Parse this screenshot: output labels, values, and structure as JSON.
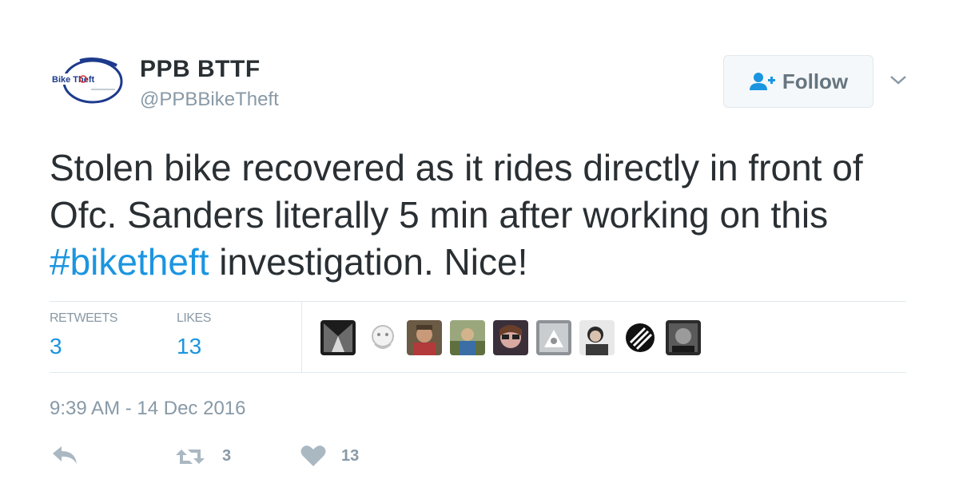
{
  "author": {
    "display_name": "PPB BTTF",
    "screen_name": "@PPBBikeTheft",
    "avatar_icon": "bike-theft-logo",
    "avatar_text": "Bike Theft"
  },
  "follow_button": {
    "label": "Follow",
    "icon": "follow-person-plus-icon"
  },
  "menu_icon": "chevron-down-icon",
  "tweet": {
    "text_before": "Stolen bike recovered as it rides directly in front of Ofc. Sanders literally 5 min after working on this ",
    "hashtag": "#biketheft",
    "text_after": " investigation. Nice!"
  },
  "stats": {
    "retweets_label": "RETWEETS",
    "retweets_value": "3",
    "likes_label": "LIKES",
    "likes_value": "13"
  },
  "liker_avatars": [
    {
      "id": "a1"
    },
    {
      "id": "a2"
    },
    {
      "id": "a3"
    },
    {
      "id": "a4"
    },
    {
      "id": "a5"
    },
    {
      "id": "a6"
    },
    {
      "id": "a7"
    },
    {
      "id": "a8"
    },
    {
      "id": "a9"
    }
  ],
  "timestamp": "9:39 AM - 14 Dec 2016",
  "actions": {
    "reply_icon": "reply-icon",
    "retweet_icon": "retweet-icon",
    "retweet_count": "3",
    "like_icon": "heart-icon",
    "like_count": "13"
  },
  "colors": {
    "link": "#1b95e0",
    "muted": "#8899a6",
    "text": "#292f33",
    "divider": "#e1e8ed"
  }
}
